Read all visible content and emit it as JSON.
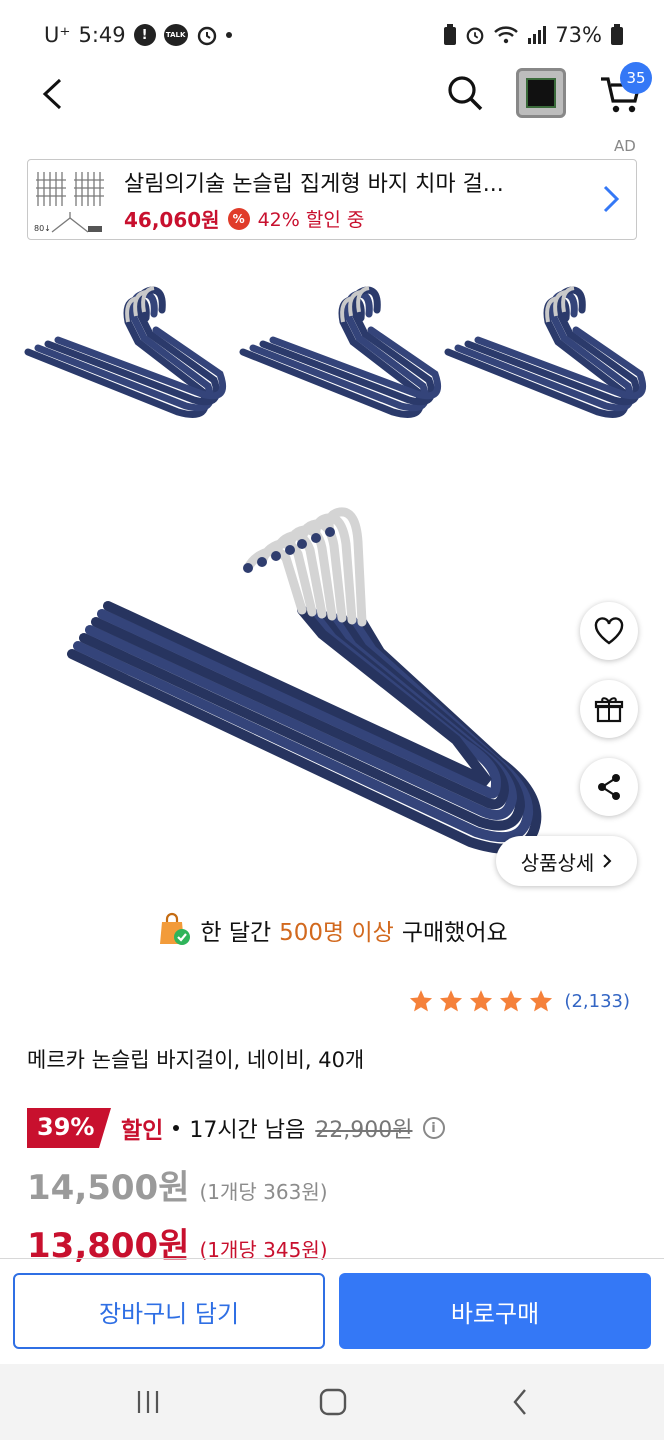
{
  "status_bar": {
    "carrier": "U⁺",
    "time": "5:49",
    "notification_badge": "!",
    "talk_badge": "TALK",
    "battery": "73%"
  },
  "header": {
    "cart_count": "35",
    "ad_label": "AD"
  },
  "ad": {
    "title": "살림의기술 논슬립 집게형 바지 치마 걸...",
    "price": "46,060원",
    "pct_symbol": "%",
    "discount": "42% 할인 중",
    "thumb_label": "80↓"
  },
  "floating": {
    "detail_label": "상품상세"
  },
  "purchase_notice": {
    "prefix": "한 달간 ",
    "highlight": "500명 이상",
    "suffix": " 구매했어요"
  },
  "rating": {
    "stars": 5,
    "review_count": "(2,133)"
  },
  "product": {
    "name": "메르카 논슬립 바지걸이, 네이비, 40개"
  },
  "pricing": {
    "discount_rate": "39%",
    "sale_label": "할인",
    "time_left": "17시간 남음",
    "original_price": "22,900원",
    "info_symbol": "i",
    "regular_price": "14,500원",
    "regular_unit": "(1개당 363원)",
    "member_price": "13,800원",
    "member_unit": "(1개당 345원)"
  },
  "actions": {
    "add_to_cart": "장바구니 담기",
    "buy_now": "바로구매"
  },
  "colors": {
    "accent_blue": "#3478f6",
    "sale_red": "#c8102e",
    "highlight_orange": "#d2691e",
    "star_orange": "#f5813a"
  }
}
